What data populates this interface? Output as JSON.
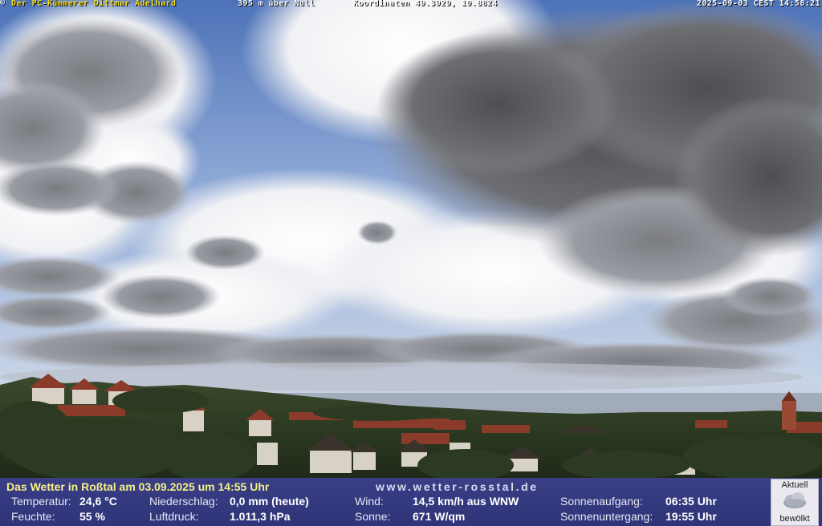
{
  "overlay": {
    "copyright": "©",
    "owner": "Der PC-Kümmerer Dittmar Adelhard",
    "altitude": "395 m über Null",
    "coordinates": "Koordinaten 49.3929, 10.8824",
    "timestamp": "2025-09-03 CEST 14:58:21"
  },
  "weather": {
    "title": "Das Wetter in Roßtal am 03.09.2025 um 14:55 Uhr",
    "site": "www.wetter-rosstal.de",
    "temperature_label": "Temperatur:",
    "temperature_value": "24,6 °C",
    "humidity_label": "Feuchte:",
    "humidity_value": "55 %",
    "precip_label": "Niederschlag:",
    "precip_value": "0,0 mm (heute)",
    "pressure_label": "Luftdruck:",
    "pressure_value": "1.011,3 hPa",
    "wind_label": "Wind:",
    "wind_value": "14,5 km/h aus WNW",
    "sun_label": "Sonne:",
    "sun_value": "671 W/qm",
    "sunrise_label": "Sonnenaufgang:",
    "sunrise_value": "06:35 Uhr",
    "sunset_label": "Sonnenuntergang:",
    "sunset_value": "19:55 Uhr",
    "current_top": "Aktuell",
    "current_icon": "cloud-icon",
    "current_bottom": "bewölkt"
  },
  "colors": {
    "owner_text": "#f8e020",
    "bar_background": "#353a7f",
    "title_text": "#f4f08a"
  }
}
